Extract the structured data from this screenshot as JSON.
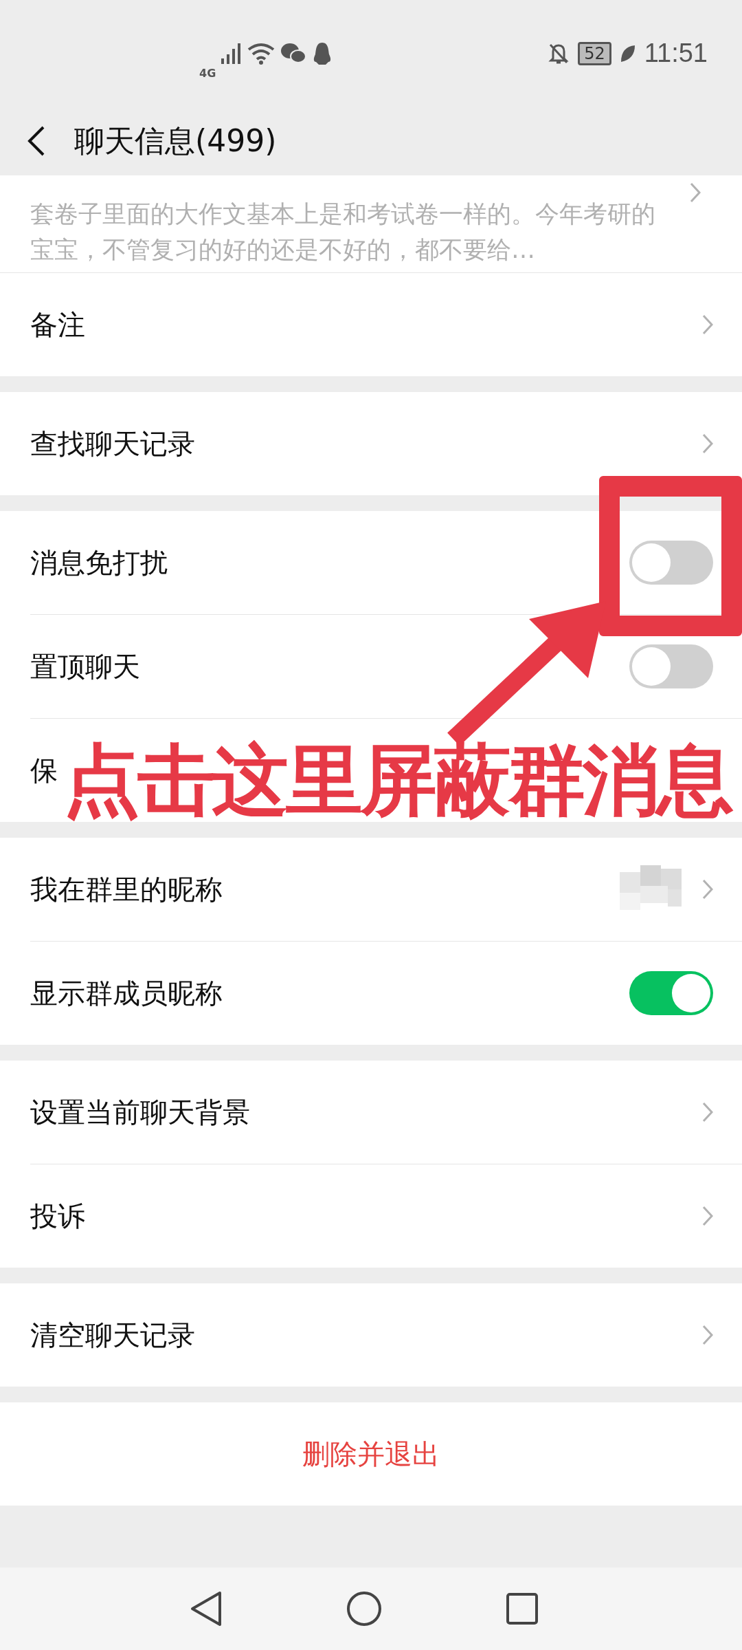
{
  "status_bar": {
    "battery": "52",
    "time": "11:51",
    "network": "4G"
  },
  "header": {
    "title": "聊天信息(499)"
  },
  "announcement": {
    "text": "套卷子里面的大作文基本上是和考试卷一样的。今年考研的宝宝，不管复习的好的还是不好的，都不要给…"
  },
  "groups": [
    [
      {
        "label": "备注",
        "kind": "link"
      }
    ],
    [
      {
        "label": "查找聊天记录",
        "kind": "link"
      }
    ],
    [
      {
        "label": "消息免打扰",
        "kind": "toggle",
        "on": false
      },
      {
        "label": "置顶聊天",
        "kind": "toggle",
        "on": false
      },
      {
        "label": "保",
        "kind": "covered"
      }
    ],
    [
      {
        "label": "我在群里的昵称",
        "kind": "nickname"
      },
      {
        "label": "显示群成员昵称",
        "kind": "toggle",
        "on": true
      }
    ],
    [
      {
        "label": "设置当前聊天背景",
        "kind": "link"
      },
      {
        "label": "投诉",
        "kind": "link"
      }
    ],
    [
      {
        "label": "清空聊天记录",
        "kind": "link"
      }
    ]
  ],
  "exit_button": "删除并退出",
  "annotation": {
    "text": "点击这里屏蔽群消息"
  }
}
